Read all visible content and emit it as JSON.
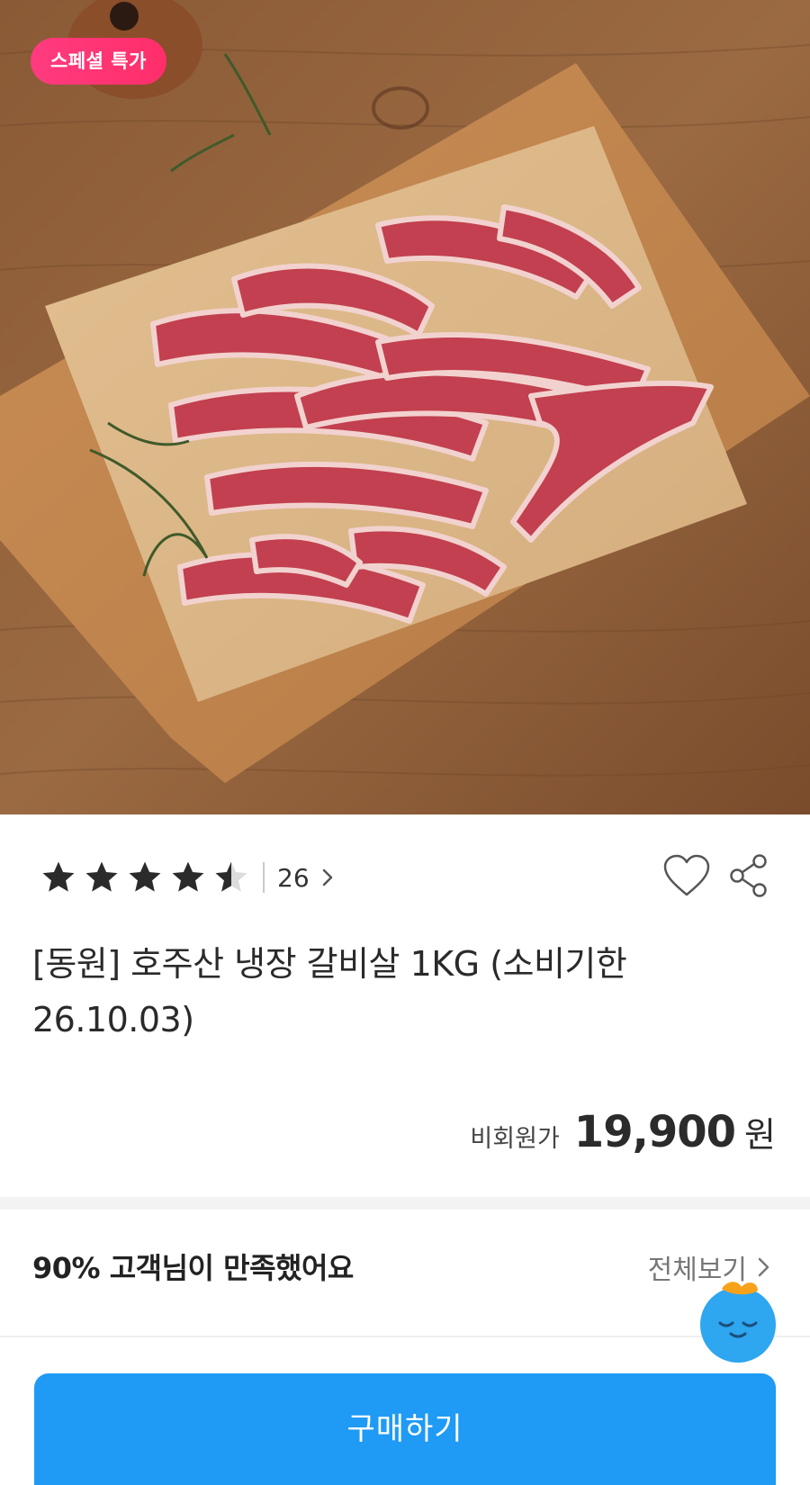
{
  "hero": {
    "badge_label": "스페셜 특가"
  },
  "rating": {
    "stars": 4.5,
    "review_count": "26"
  },
  "product": {
    "title": "[동원] 호주산 냉장 갈비살 1KG (소비기한 26.10.03)"
  },
  "price": {
    "label": "비회원가",
    "value": "19,900",
    "unit": "원"
  },
  "satisfaction": {
    "text": "90% 고객님이 만족했어요",
    "view_all_label": "전체보기"
  },
  "buy_button_label": "구매하기",
  "colors": {
    "accent_blue": "#1f9af5",
    "badge_pink": "#ff2e6a",
    "mascot_blue": "#2ea6f0",
    "mascot_orange": "#f7a21b"
  },
  "icons": [
    "star-icon",
    "chevron-right-icon",
    "heart-icon",
    "share-icon",
    "mascot-icon"
  ]
}
